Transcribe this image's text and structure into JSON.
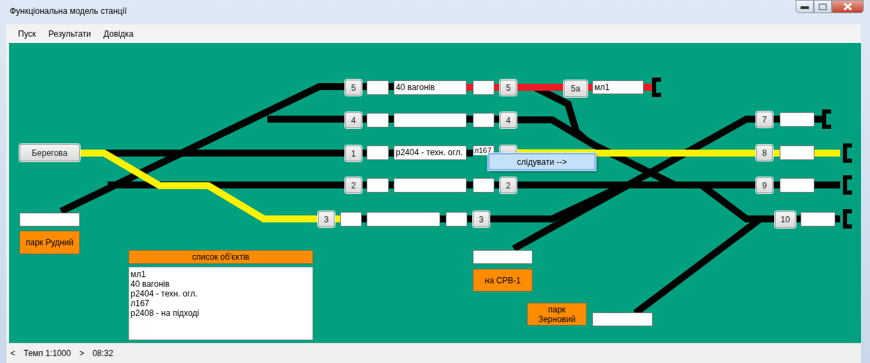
{
  "window": {
    "title": "Функціональна модель станції"
  },
  "menu": [
    "Пуск",
    "Результати",
    "Довідка"
  ],
  "track_segments": [
    {
      "color": "#000000"
    },
    {
      "color": "#ed1c24"
    },
    {
      "color": "#000000"
    },
    {
      "color": "#000000"
    },
    {
      "color": "#000000"
    },
    {
      "color": "#fff200"
    },
    {
      "color": "#fff200"
    },
    {
      "color": "#000000"
    },
    {
      "color": "#000000"
    },
    {
      "color": "#000000"
    },
    {
      "color": "#000000"
    },
    {
      "color": "#000000"
    }
  ],
  "track_buttons": [
    "5",
    "4",
    "1",
    "2",
    "3",
    "5",
    "4",
    "2",
    "3",
    "5а",
    "7",
    "8",
    "9",
    "10"
  ],
  "wagon_fields": [
    {
      "value": "40 вагонів"
    },
    {
      "value": "р2404 - техн. огл."
    },
    {
      "value": "л167"
    },
    {
      "value": "мл1"
    }
  ],
  "station_button": "Берегова",
  "parks": [
    "парк Рудний",
    "на СРВ-1",
    "парк Зерновий"
  ],
  "object_list": {
    "title": "список об'єктів",
    "items": [
      "мл1",
      "40 вагонів",
      "р2404 - техн. огл.",
      "л167",
      "р2408 - на підході"
    ]
  },
  "context_menu": {
    "label": "слідувати -->"
  },
  "status_bar": {
    "prev": "<",
    "tempo": "Темп 1:1000",
    "next": ">",
    "time": "08:32"
  }
}
